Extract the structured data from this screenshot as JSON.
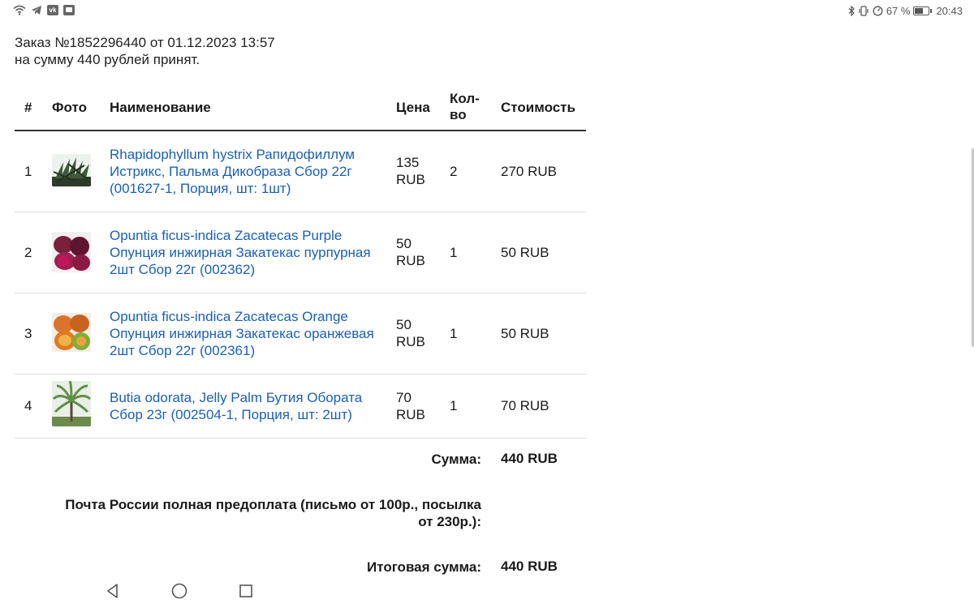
{
  "status_bar": {
    "battery_percent": "67 %",
    "battery_level": 0.67,
    "time": "20:43",
    "vk_label": "vk",
    "left_icons": [
      "wifi-icon",
      "telegram-icon",
      "vk-icon",
      "ok-icon"
    ],
    "right_icons": [
      "bluetooth-icon",
      "vibrate-icon",
      "data-saver-icon",
      "battery-icon"
    ]
  },
  "order": {
    "line1": "Заказ №1852296440 от 01.12.2023 13:57",
    "line2": "на сумму 440 рублей принят."
  },
  "table": {
    "headers": {
      "num": "#",
      "photo": "Фото",
      "name": "Наименование",
      "price": "Цена",
      "qty_line1": "Кол-",
      "qty_line2": "во",
      "cost": "Стоимость"
    },
    "rows": [
      {
        "num": "1",
        "name": "Rhapidophyllum hystrix Рапидофиллум Истрикс, Пальма Дикобраза Сбор 22г (001627-1, Порция, шт: 1шт)",
        "price_value": "135",
        "price_unit": "RUB",
        "qty": "2",
        "cost": "270 RUB"
      },
      {
        "num": "2",
        "name": "Opuntia ficus-indica Zacatecas Purple Опунция инжирная Закатекас пурпурная 2шт Сбор 22г (002362)",
        "price_value": "50",
        "price_unit": "RUB",
        "qty": "1",
        "cost": "50 RUB"
      },
      {
        "num": "3",
        "name": "Opuntia ficus-indica Zacatecas Orange Опунция инжирная Закатекас оранжевая 2шт Сбор 22г (002361)",
        "price_value": "50",
        "price_unit": "RUB",
        "qty": "1",
        "cost": "50 RUB"
      },
      {
        "num": "4",
        "name": "Butia odorata, Jelly Palm Бутия Обората Сбор 23г (002504-1, Порция, шт: 2шт)",
        "price_value": "70",
        "price_unit": "RUB",
        "qty": "1",
        "cost": "70 RUB"
      }
    ]
  },
  "summary": {
    "sum_label": "Сумма:",
    "sum_value": "440 RUB",
    "delivery_line1": "Почта России полная предоплата (письмо от 100р., посылка",
    "delivery_line2": "от 230р.):",
    "total_label": "Итоговая сумма:",
    "total_value": "440 RUB"
  },
  "colors": {
    "link": "#1a5fb4",
    "text": "#1a1a1a",
    "header_rule": "#333333",
    "row_rule": "#dddddd"
  }
}
